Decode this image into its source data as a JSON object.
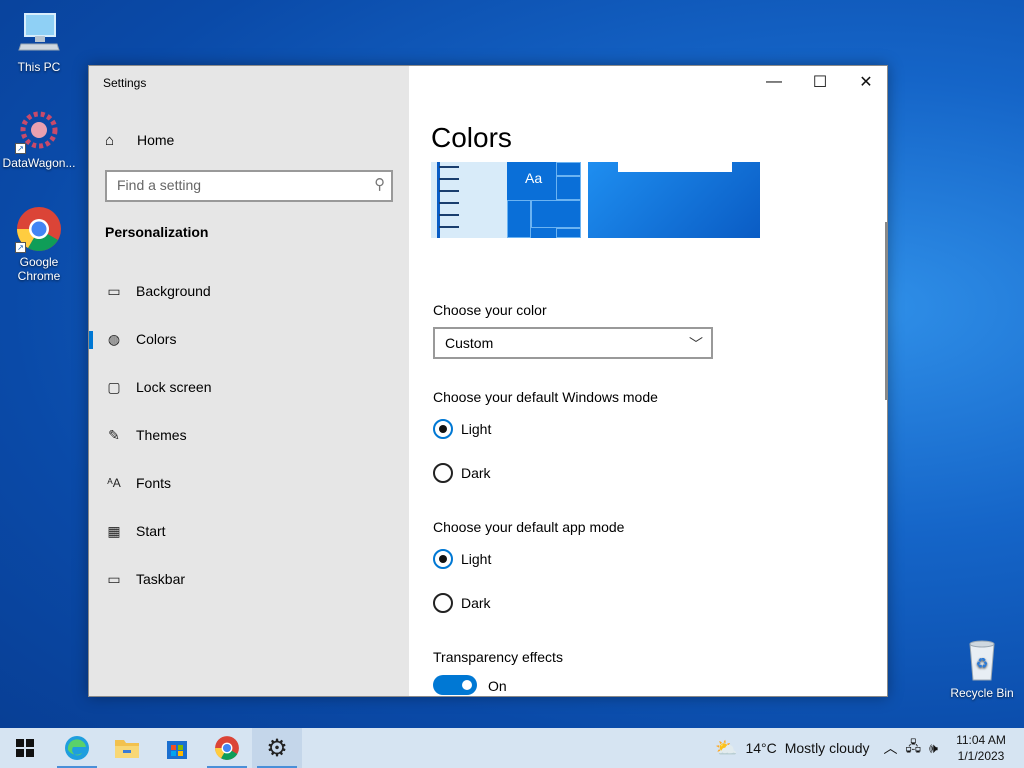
{
  "desktop": {
    "icons": [
      {
        "label": "This PC"
      },
      {
        "label": "DataWagon..."
      },
      {
        "label": "Google Chrome"
      },
      {
        "label": "Recycle Bin"
      }
    ]
  },
  "window": {
    "title": "Settings",
    "controls": {
      "minimize": "—",
      "maximize": "☐",
      "close": "✕"
    }
  },
  "sidebar": {
    "home_label": "Home",
    "search_placeholder": "Find a setting",
    "section_header": "Personalization",
    "items": [
      {
        "label": "Background",
        "icon": "image-icon"
      },
      {
        "label": "Colors",
        "icon": "palette-icon",
        "active": true
      },
      {
        "label": "Lock screen",
        "icon": "lock-screen-icon"
      },
      {
        "label": "Themes",
        "icon": "brush-icon"
      },
      {
        "label": "Fonts",
        "icon": "font-icon"
      },
      {
        "label": "Start",
        "icon": "start-icon"
      },
      {
        "label": "Taskbar",
        "icon": "taskbar-icon"
      }
    ]
  },
  "main": {
    "title": "Colors",
    "preview_sample_text": "Aa",
    "choose_color_label": "Choose your color",
    "choose_color_value": "Custom",
    "windows_mode_label": "Choose your default Windows mode",
    "windows_mode_options": [
      "Light",
      "Dark"
    ],
    "windows_mode_selected": "Light",
    "app_mode_label": "Choose your default app mode",
    "app_mode_options": [
      "Light",
      "Dark"
    ],
    "app_mode_selected": "Light",
    "transparency_label": "Transparency effects",
    "transparency_state": "On"
  },
  "taskbar": {
    "weather_temp": "14°C",
    "weather_text": "Mostly cloudy",
    "time": "11:04 AM",
    "date": "1/1/2023",
    "accent": "#0078d4"
  }
}
